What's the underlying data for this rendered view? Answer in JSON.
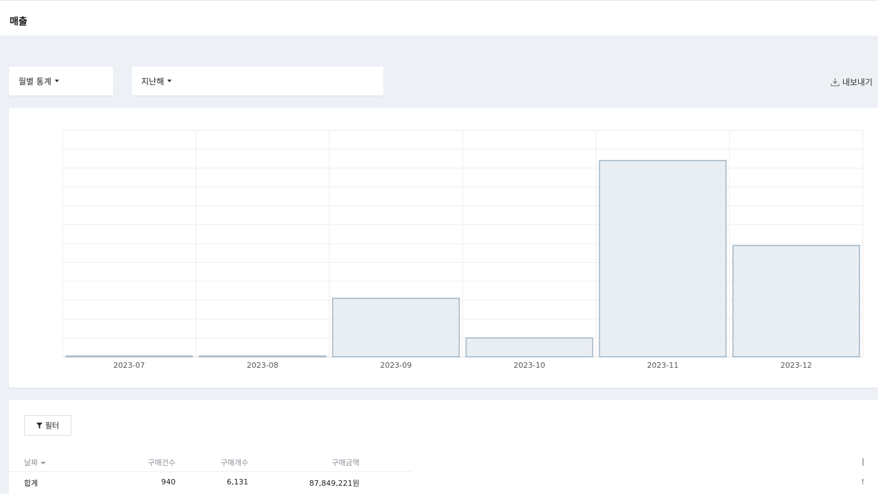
{
  "page": {
    "title": "매출"
  },
  "filters": {
    "period": "월별 통계",
    "range": "지난해",
    "export": "내보내기"
  },
  "chart_data": {
    "type": "bar",
    "categories": [
      "2023-07",
      "2023-08",
      "2023-09",
      "2023-10",
      "2023-11",
      "2023-12"
    ],
    "values": [
      0.3,
      0.3,
      31,
      10,
      104,
      59
    ],
    "ylim": [
      0,
      120
    ],
    "grid": true,
    "colors": {
      "fill": "#e9eef3",
      "stroke": "#9fb3c6",
      "grid": "#eeeeee"
    }
  },
  "table": {
    "filter_label": "필터",
    "headers": {
      "date": "날짜",
      "orders": "구매건수",
      "items": "구매개수",
      "amount": "구매금액"
    },
    "summary": {
      "label": "합계",
      "orders": "940",
      "items": "6,131",
      "amount": "87,849,221원"
    },
    "right_marks": [
      "|",
      "!"
    ]
  }
}
